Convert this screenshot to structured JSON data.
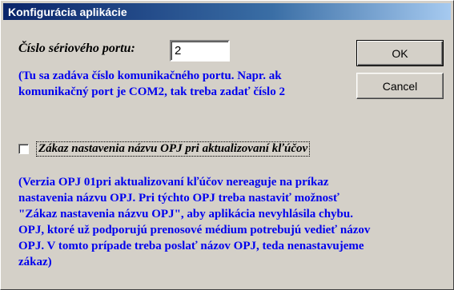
{
  "window": {
    "title": "Konfigurácia aplikácie"
  },
  "serial": {
    "label": "Číslo sériového portu:",
    "value": "2"
  },
  "info_port": {
    "lines": [
      "(Tu sa zadáva číslo komunikačného portu. Napr. ak",
      "komunikačný port je COM2, tak treba zadať číslo 2"
    ]
  },
  "buttons": {
    "ok": "OK",
    "cancel": "Cancel"
  },
  "checkbox": {
    "label": "Zákaz nastavenia názvu OPJ pri aktualizovaní kľúčov",
    "checked": false
  },
  "info_opj": {
    "lines": [
      "(Verzia OPJ 01pri aktualizovaní kľúčov nereaguje na príkaz",
      "nastavenia názvu OPJ. Pri týchto OPJ treba nastaviť možnosť",
      "\"Zákaz nastavenia názvu OPJ\", aby aplikácia nevyhlásila chybu.",
      "OPJ, ktoré už podporujú prenosové médium potrebujú vedieť názov",
      "OPJ. V tomto prípade treba poslať názov OPJ, teda nenastavujeme",
      "zákaz)"
    ]
  },
  "colors": {
    "info_text": "#0000ee",
    "title_bar_start": "#0a246a",
    "title_bar_end": "#a6caf0",
    "face": "#d4d0c8"
  }
}
